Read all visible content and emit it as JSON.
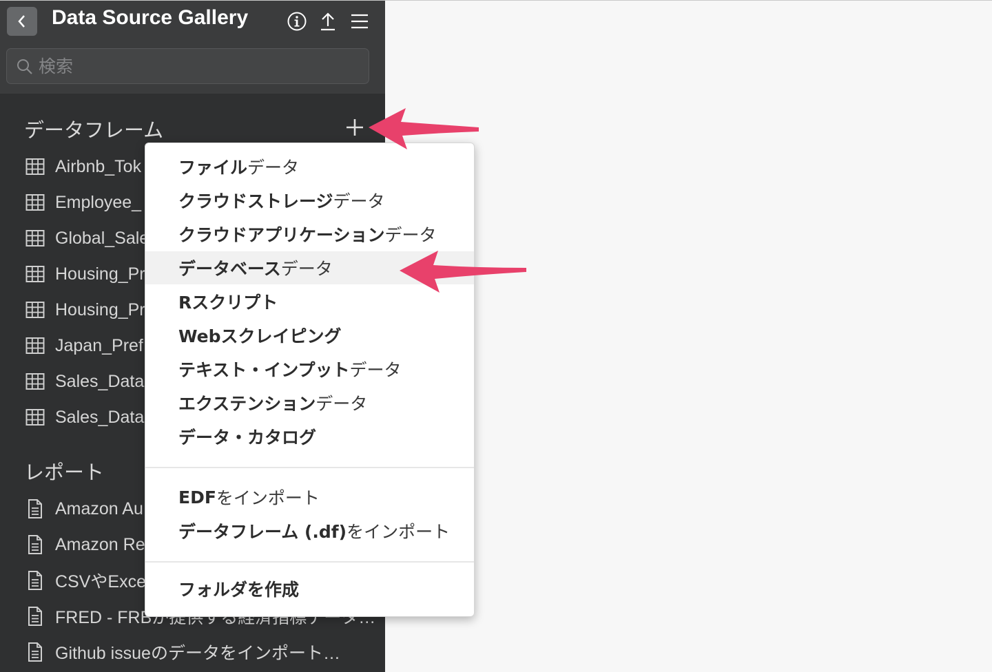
{
  "header": {
    "title": "Data Source Gallery",
    "back_icon": "chevron-left-icon",
    "icons": [
      "info-icon",
      "upload-icon",
      "menu-icon"
    ]
  },
  "search": {
    "placeholder": "検索",
    "value": ""
  },
  "dataframes": {
    "title": "データフレーム",
    "add_icon": "plus-icon",
    "items": [
      {
        "label": "Airbnb_Tok"
      },
      {
        "label": "Employee_"
      },
      {
        "label": "Global_Sale"
      },
      {
        "label": "Housing_Pr"
      },
      {
        "label": "Housing_Pr"
      },
      {
        "label": "Japan_Pref"
      },
      {
        "label": "Sales_Data"
      },
      {
        "label": "Sales_Data"
      }
    ]
  },
  "reports": {
    "title": "レポート",
    "items": [
      {
        "label": "Amazon Au"
      },
      {
        "label": "Amazon Re"
      },
      {
        "label": "CSVやExce"
      },
      {
        "label": "FRED - FRBが提供する経済指標データ…"
      },
      {
        "label": "Github issueのデータをインポート…"
      }
    ]
  },
  "menu": {
    "groups": [
      [
        {
          "bold": "ファイル",
          "light": "データ"
        },
        {
          "bold": "クラウドストレージ",
          "light": "データ"
        },
        {
          "bold": "クラウドアプリケーション",
          "light": "データ"
        },
        {
          "bold": "データベース",
          "light": "データ",
          "highlighted": true
        },
        {
          "bold": "Rスクリプト",
          "light": ""
        },
        {
          "bold": "Webスクレイピング",
          "light": ""
        },
        {
          "bold": "テキスト・インプット",
          "light": "データ"
        },
        {
          "bold": "エクステンション",
          "light": "データ"
        },
        {
          "bold": "データ・カタログ",
          "light": ""
        }
      ],
      [
        {
          "bold": "EDF",
          "light": "をインポート"
        },
        {
          "bold": "データフレーム (.df)",
          "light": "をインポート"
        }
      ],
      [
        {
          "bold": "フォルダを作成",
          "light": ""
        }
      ]
    ]
  },
  "colors": {
    "sidebar_bg": "#2f3031",
    "header_bg": "#3b3c3d",
    "arrow": "#e8416b",
    "menu_highlight": "#f1f1f1"
  }
}
